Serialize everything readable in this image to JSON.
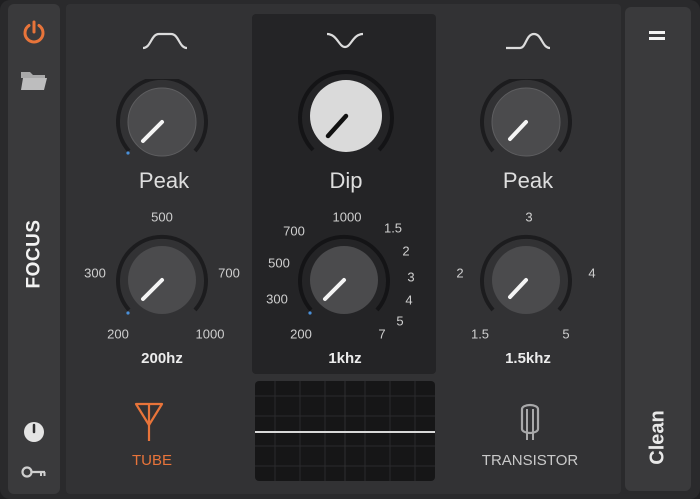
{
  "colors": {
    "accent": "#e8743a",
    "panel": "#323234",
    "center_panel": "#242426",
    "strip": "#3a3a3c",
    "knob_dark": "#4a4a4c",
    "knob_light": "#d9d9d9"
  },
  "sidebar_left": {
    "label": "FOCUS",
    "icons": [
      "power-icon",
      "folder-icon",
      "clock-icon",
      "key-icon"
    ]
  },
  "sidebar_right": {
    "label": "Clean",
    "icons": [
      "menu-icon"
    ]
  },
  "bands": [
    {
      "shape_icon": "low-shelf-curve-icon",
      "type_label": "Peak",
      "freq_ticks": [
        "500",
        "300",
        "700",
        "200",
        "1000"
      ],
      "freq_value": "200hz"
    },
    {
      "shape_icon": "dip-curve-icon",
      "type_label": "Dip",
      "freq_ticks": [
        "1000",
        "700",
        "500",
        "300",
        "200",
        "1.5",
        "2",
        "3",
        "4",
        "5",
        "7"
      ],
      "freq_value": "1khz"
    },
    {
      "shape_icon": "high-shelf-curve-icon",
      "type_label": "Peak",
      "freq_ticks": [
        "3",
        "2",
        "4",
        "1.5",
        "5"
      ],
      "freq_value": "1.5khz"
    }
  ],
  "modes": {
    "tube": {
      "label": "TUBE",
      "icon": "tube-icon",
      "active": true
    },
    "transistor": {
      "label": "TRANSISTOR",
      "icon": "transistor-icon",
      "active": false
    }
  }
}
